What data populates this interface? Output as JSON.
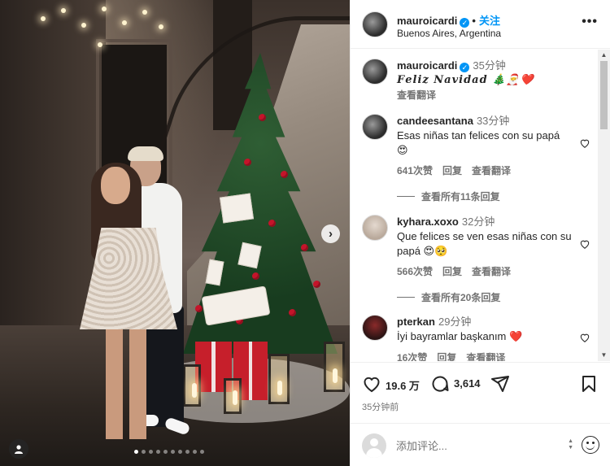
{
  "post": {
    "username": "mauroicardi",
    "follow_label": "关注",
    "location": "Buenos Aires, Argentina",
    "more_icon": "more-horizontal-icon",
    "photo_dots": 10,
    "photo_active_dot": 0
  },
  "caption": {
    "username": "mauroicardi",
    "time": "35分钟",
    "text": "𝑭𝒆𝒍𝒊𝒛 𝑵𝒂𝒗𝒊𝒅𝒂𝒅 🎄🎅❤️",
    "see_translation": "查看翻译"
  },
  "comments": [
    {
      "username": "candeesantana",
      "time": "33分钟",
      "text": "Esas niñas tan felices con su papá 😍",
      "likes": "641次赞",
      "reply": "回复",
      "translate": "查看翻译",
      "view_replies": "查看所有11条回复"
    },
    {
      "username": "kyhara.xoxo",
      "time": "32分钟",
      "text": "Que felices se ven esas niñas con su papá 😍🥺",
      "likes": "566次赞",
      "reply": "回复",
      "translate": "查看翻译",
      "view_replies": "查看所有20条回复"
    },
    {
      "username": "pterkan",
      "time": "29分钟",
      "text": "İyi bayramlar başkanım ❤️",
      "likes": "16次赞",
      "reply": "回复",
      "translate": "查看翻译"
    }
  ],
  "actions": {
    "like_icon": "heart-icon",
    "likes_count": "19.6 万",
    "comment_icon": "comment-icon",
    "comments_count": "3,614",
    "share_icon": "share-icon",
    "save_icon": "bookmark-icon",
    "posted_time": "35分钟前"
  },
  "add_comment": {
    "placeholder": "添加评论..."
  },
  "colors": {
    "accent": "#0095f6",
    "text": "#262626",
    "secondary": "#737373",
    "heart_red": "#ed4956"
  }
}
